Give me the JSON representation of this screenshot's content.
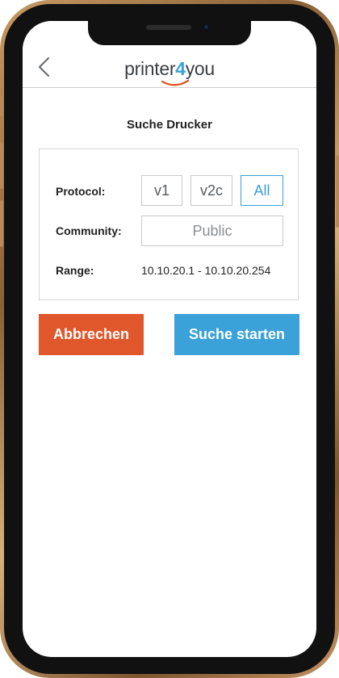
{
  "app": {
    "logo_prefix": "printer",
    "logo_number": "4",
    "logo_suffix": "you",
    "brand_blue": "#3aa1d9",
    "brand_orange": "#e0572c"
  },
  "header": {
    "back_icon": "chevron-left-icon"
  },
  "page": {
    "title": "Suche Drucker"
  },
  "form": {
    "protocol_label": "Protocol:",
    "protocol_options": [
      "v1",
      "v2c",
      "All"
    ],
    "protocol_selected": "All",
    "community_label": "Community:",
    "community_placeholder": "Public",
    "range_label": "Range:",
    "range_value": "10.10.20.1 - 10.10.20.254"
  },
  "actions": {
    "cancel_label": "Abbrechen",
    "start_label": "Suche starten"
  }
}
